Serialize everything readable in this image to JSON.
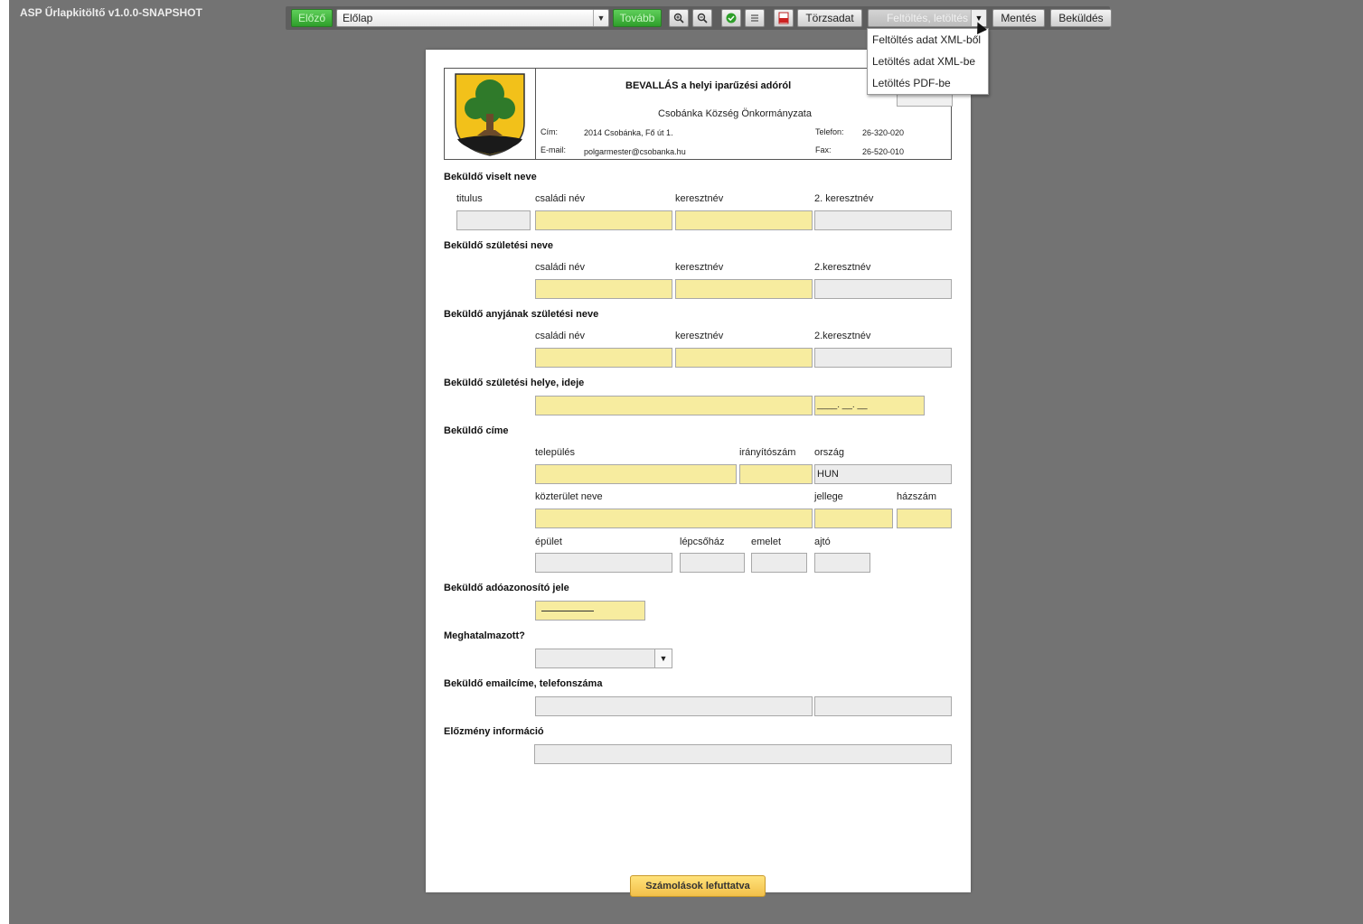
{
  "app": {
    "title": "ASP Űrlapkitöltő v1.0.0-SNAPSHOT"
  },
  "toolbar": {
    "prev": "Előző",
    "page_select": "Előlap",
    "next": "Tovább",
    "zoom_in_icon": "zoom-in-icon",
    "zoom_out_icon": "zoom-out-icon",
    "check_icon": "check-icon",
    "list_icon": "list-icon",
    "pdf_icon": "pdf-icon",
    "master_data": "Törzsadat",
    "upload_download": "Feltöltés, letöltés",
    "save": "Mentés",
    "submit": "Beküldés"
  },
  "menu": {
    "items": [
      "Feltöltés adat XML-ből",
      "Letöltés adat XML-be",
      "Letöltés PDF-be"
    ]
  },
  "header": {
    "title": "BEVALLÁS a helyi iparűzési adóról",
    "organization": "Csobánka Község Önkormányzata",
    "address_label": "Cím:",
    "address": "2014 Csobánka, Fő út 1.",
    "email_label": "E-mail:",
    "email": "polgarmester@csobanka.hu",
    "phone_label": "Telefon:",
    "phone": "26-320-020",
    "fax_label": "Fax:",
    "fax": "26-520-010"
  },
  "sections": {
    "name": "Beküldő viselt neve",
    "birth_name": "Beküldő születési neve",
    "mother_name": "Beküldő anyjának születési neve",
    "birth_place": "Beküldő születési helye, ideje",
    "address": "Beküldő címe",
    "tax_id": "Beküldő adóazonosító jele",
    "authorized": "Meghatalmazott?",
    "contact": "Beküldő emailcíme, telefonszáma",
    "history": "Előzmény információ"
  },
  "labels": {
    "titulus": "titulus",
    "family": "családi név",
    "given": "keresztnév",
    "given2": "2. keresztnév",
    "given2b": "2.keresztnév",
    "town": "település",
    "zip": "irányítószám",
    "country": "ország",
    "street": "közterület neve",
    "street_type": "jellege",
    "house_no": "házszám",
    "building": "épület",
    "stairs": "lépcsőház",
    "floor": "emelet",
    "door": "ajtó"
  },
  "values": {
    "country": "HUN",
    "date_mask": "____. __. __"
  },
  "calc_button": "Számolások lefuttatva"
}
